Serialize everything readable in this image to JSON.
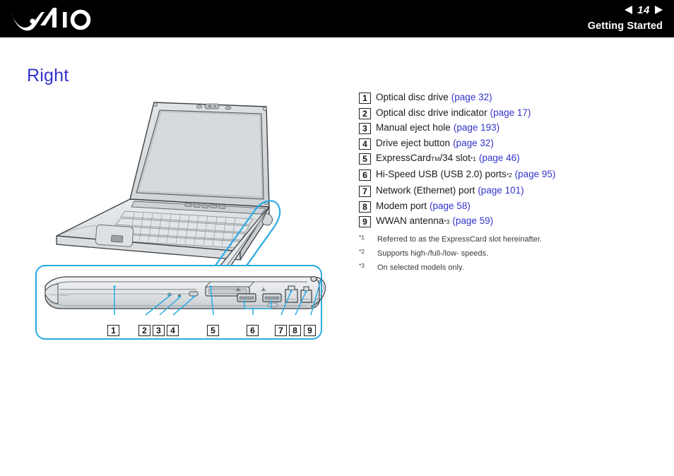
{
  "header": {
    "logo_name": "vaio-logo",
    "page_number": "14",
    "section_title": "Getting Started",
    "prev_arrow": "prev-page-arrow",
    "next_arrow": "next-page-arrow"
  },
  "page": {
    "heading": "Right",
    "heading_color": "#3333cc",
    "link_color": "#3333cc",
    "highlight_color": "#29abe2"
  },
  "legend": {
    "items": [
      {
        "num": "1",
        "label": "Optical disc drive",
        "link": "(page 32)"
      },
      {
        "num": "2",
        "label": "Optical disc drive indicator",
        "link": "(page 17)"
      },
      {
        "num": "3",
        "label": "Manual eject hole",
        "link": "(page 193)"
      },
      {
        "num": "4",
        "label": "Drive eject button",
        "link": "(page 32)"
      },
      {
        "num": "5",
        "label": "ExpressCard",
        "sup1": "TM",
        "label2": "/34 slot",
        "sup2": "*1",
        "link": "(page 46)"
      },
      {
        "num": "6",
        "label": "Hi-Speed USB (USB 2.0) ports",
        "sup2": "*2",
        "link": "(page 95)"
      },
      {
        "num": "7",
        "label": "Network (Ethernet) port",
        "link": "(page 101)"
      },
      {
        "num": "8",
        "label": "Modem port",
        "link": "(page 58)"
      },
      {
        "num": "9",
        "label": "WWAN antenna",
        "sup2": "*3",
        "link": "(page 59)"
      }
    ]
  },
  "footnotes": [
    {
      "mark": "*1",
      "text": "Referred to as the ExpressCard slot hereinafter."
    },
    {
      "mark": "*2",
      "text": "Supports high-/full-/low- speeds."
    },
    {
      "mark": "*3",
      "text": "On selected models only."
    }
  ],
  "illustration": {
    "alt": "Laptop shown in three-quarter view with the right side edge highlighted, and a magnified detail of the right edge below showing numbered ports",
    "callouts": [
      "1",
      "2",
      "3",
      "4",
      "5",
      "6",
      "7",
      "8",
      "9"
    ]
  }
}
